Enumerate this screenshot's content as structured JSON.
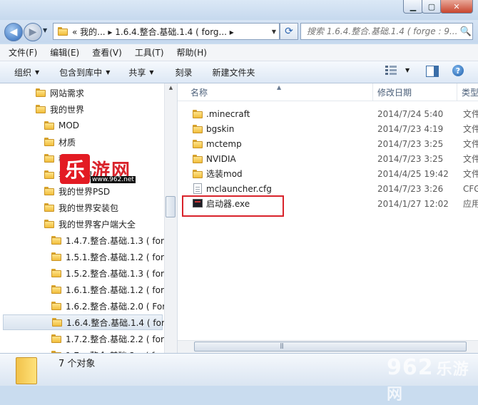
{
  "window": {
    "controls": {
      "minimize": "▁",
      "maximize": "▢",
      "close": "✕"
    }
  },
  "address_bar": {
    "path_text": "«  我的...  ▸ 1.6.4.整合.基础.1.4 ( forg...  ▸",
    "search_placeholder": "搜索 1.6.4.整合.基础.1.4 ( forge : 9...",
    "back_glyph": "◀",
    "forward_glyph": "▶",
    "history_glyph": "▼",
    "refresh_glyph": "⟳",
    "search_glyph": "🔍"
  },
  "menu": [
    "文件(F)",
    "编辑(E)",
    "查看(V)",
    "工具(T)",
    "帮助(H)"
  ],
  "toolbar": {
    "organize": "组织",
    "include_in_library": "包含到库中",
    "share": "共享",
    "burn": "刻录",
    "new_folder": "新建文件夹",
    "help_glyph": "?"
  },
  "nav_tree": [
    {
      "label": "网站需求",
      "indent": 1
    },
    {
      "label": "我的世界",
      "indent": 1
    },
    {
      "label": "MOD",
      "indent": 2
    },
    {
      "label": "材质",
      "indent": 2
    },
    {
      "label": "教程",
      "indent": 2
    },
    {
      "label": "我的世界",
      "indent": 2
    },
    {
      "label": "我的世界PSD",
      "indent": 2
    },
    {
      "label": "我的世界安装包",
      "indent": 2
    },
    {
      "label": "我的世界客户端大全",
      "indent": 2
    },
    {
      "label": "1.4.7.整合.基础.1.3 ( forg",
      "indent": 3
    },
    {
      "label": "1.5.1.整合.基础.1.2 ( forg",
      "indent": 3
    },
    {
      "label": "1.5.2.整合.基础.1.3 ( forg",
      "indent": 3
    },
    {
      "label": "1.6.1.整合.基础.1.2 ( forg",
      "indent": 3
    },
    {
      "label": "1.6.2.整合.基础.2.0 ( Forg",
      "indent": 3
    },
    {
      "label": "1.6.4.整合.基础.1.4 ( forg",
      "indent": 3,
      "selected": true
    },
    {
      "label": "1.7.2.整合.基础.2.2 ( forg",
      "indent": 3
    },
    {
      "label": "1.7.x.整合.基础.2.x ( forg",
      "indent": 3
    }
  ],
  "columns": {
    "name": "名称",
    "date": "修改日期",
    "type": "类型"
  },
  "files": [
    {
      "name": ".minecraft",
      "date": "2014/7/24 5:40",
      "type": "文件",
      "icon": "folder"
    },
    {
      "name": "bgskin",
      "date": "2014/7/23 4:19",
      "type": "文件",
      "icon": "folder"
    },
    {
      "name": "mctemp",
      "date": "2014/7/23 3:25",
      "type": "文件",
      "icon": "folder"
    },
    {
      "name": "NVIDIA",
      "date": "2014/7/23 3:25",
      "type": "文件",
      "icon": "folder"
    },
    {
      "name": "选装mod",
      "date": "2014/4/25 19:42",
      "type": "文件",
      "icon": "folder"
    },
    {
      "name": "mclauncher.cfg",
      "date": "2014/7/23 3:26",
      "type": "CFG",
      "icon": "cfg"
    },
    {
      "name": "启动器.exe",
      "date": "2014/1/27 12:02",
      "type": "应用",
      "icon": "exe"
    }
  ],
  "status": {
    "item_count": "7 个对象"
  },
  "watermark": {
    "logo_char": "乐",
    "logo_text": "游网",
    "url": "www.962.net",
    "corner_num": "962",
    "corner_cn": "乐游网"
  },
  "colors": {
    "highlight": "#d9232b",
    "accent": "#2a66b8"
  }
}
